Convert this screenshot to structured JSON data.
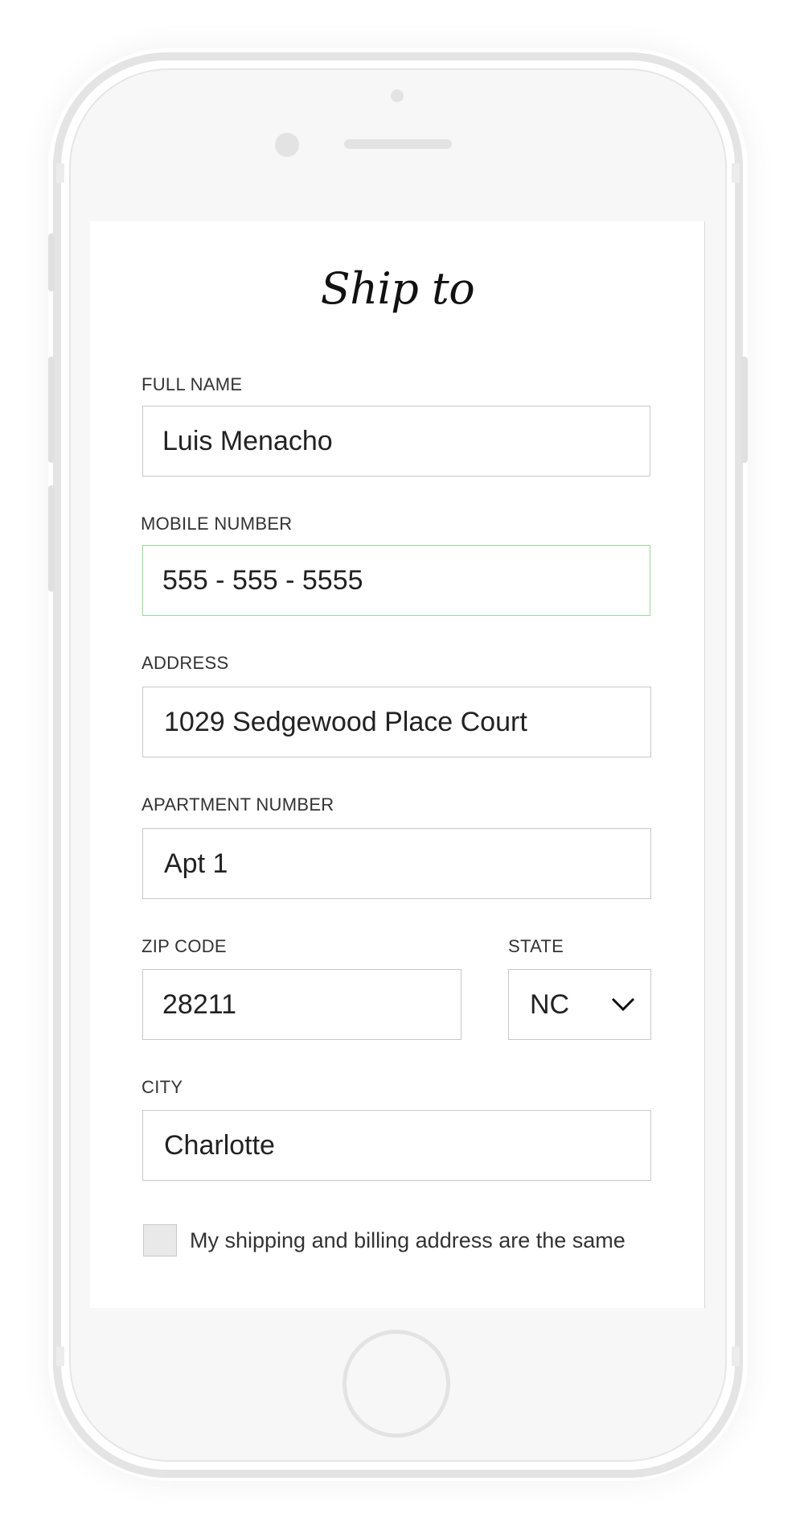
{
  "form": {
    "title": "Ship to",
    "full_name": {
      "label": "FULL NAME",
      "value": "Luis Menacho"
    },
    "mobile_number": {
      "label": "MOBILE NUMBER",
      "value": "555 - 555 - 5555"
    },
    "address": {
      "label": "ADDRESS",
      "value": "1029 Sedgewood Place Court"
    },
    "apartment_number": {
      "label": "APARTMENT NUMBER",
      "value": "Apt 1"
    },
    "zip_code": {
      "label": "ZIP CODE",
      "value": "28211"
    },
    "state": {
      "label": "STATE",
      "value": "NC"
    },
    "city": {
      "label": "CITY",
      "value": "Charlotte"
    },
    "same_address_checkbox": {
      "label": "My shipping and billing address are the same",
      "checked": false
    }
  },
  "colors": {
    "active_border": "#9dd79c",
    "field_border": "#c8c8c8",
    "phone_frame": "#e4e4e4"
  },
  "icons": {
    "state_dropdown": "chevron-down-icon"
  }
}
